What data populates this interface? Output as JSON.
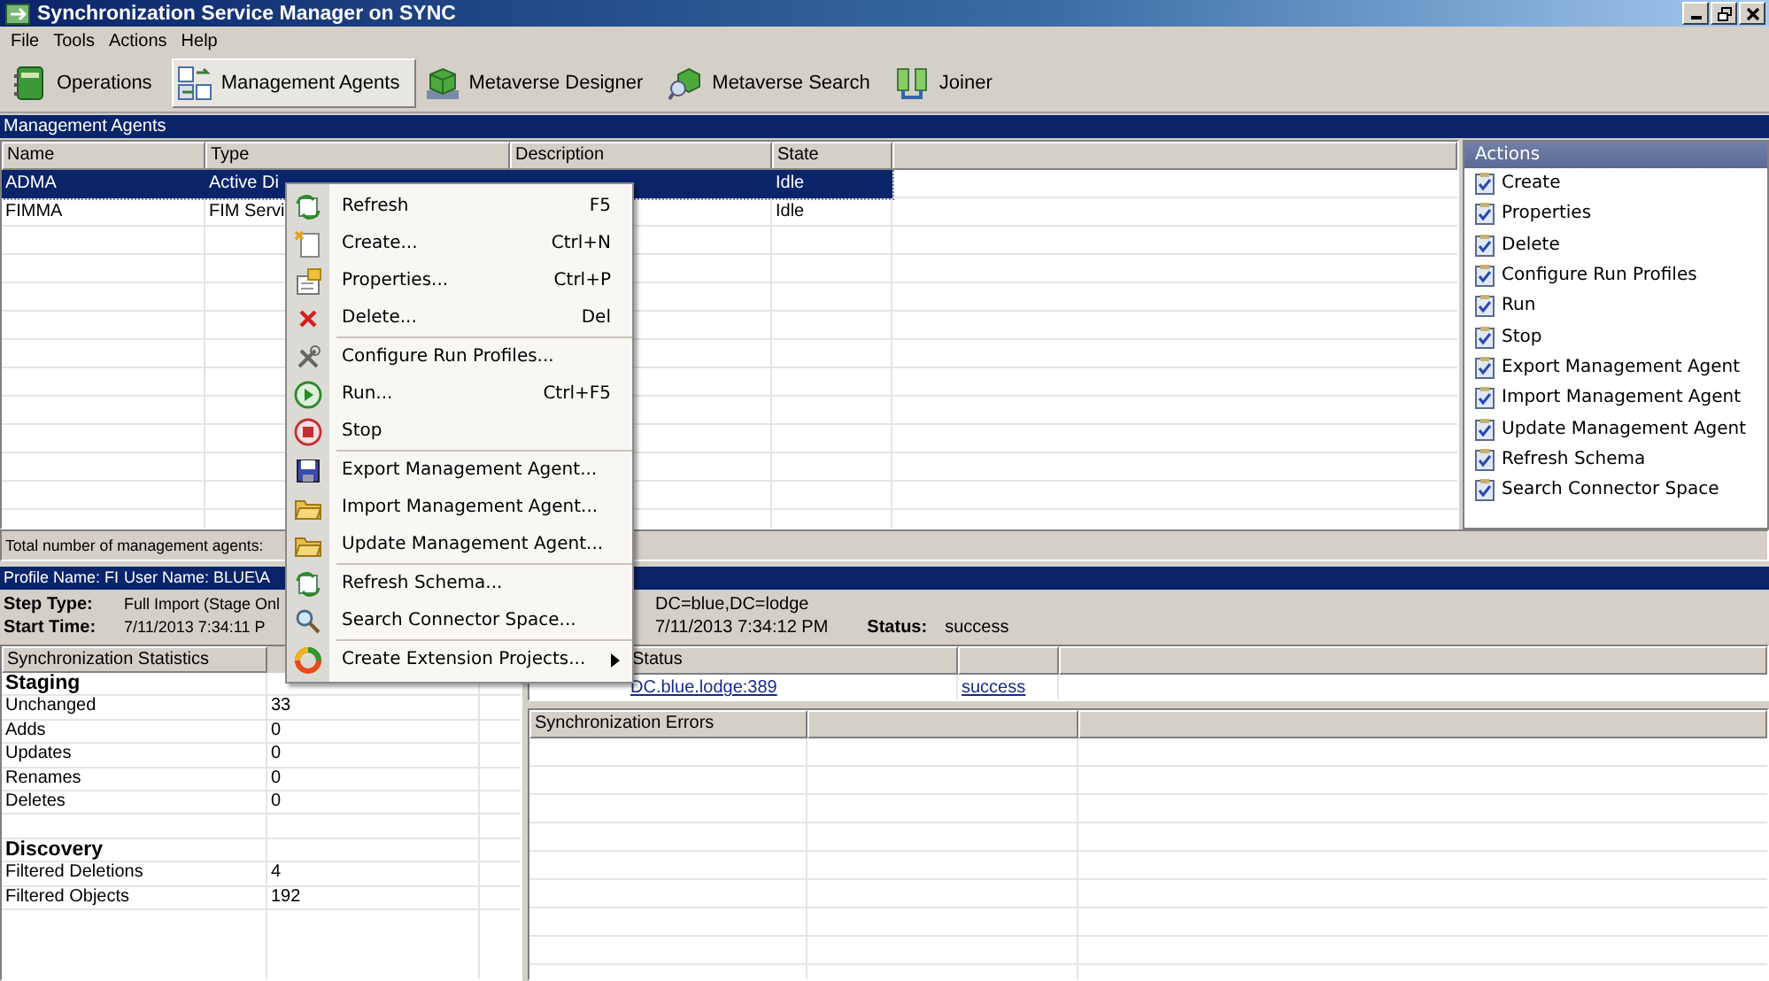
{
  "window": {
    "title": "Synchronization Service Manager on SYNC"
  },
  "menu_bar": [
    "File",
    "Tools",
    "Actions",
    "Help"
  ],
  "toolbar": [
    {
      "label": "Operations",
      "selected": false
    },
    {
      "label": "Management Agents",
      "selected": true
    },
    {
      "label": "Metaverse Designer",
      "selected": false
    },
    {
      "label": "Metaverse Search",
      "selected": false
    },
    {
      "label": "Joiner",
      "selected": false
    }
  ],
  "agents": {
    "title": "Management Agents",
    "columns": [
      "Name",
      "Type",
      "Description",
      "State"
    ],
    "rows": [
      {
        "cells": [
          "ADMA",
          "Active Di",
          "",
          "Idle"
        ],
        "selected": true
      },
      {
        "cells": [
          "FIMMA",
          "FIM Servi",
          "",
          "Idle"
        ],
        "selected": false
      }
    ],
    "footer": "Total number of management agents:"
  },
  "actions": {
    "title": "Actions",
    "items": [
      "Create",
      "Properties",
      "Delete",
      "Configure Run Profiles",
      "Run",
      "Stop",
      "Export Management Agent",
      "Import Management Agent",
      "Update Management Agent",
      "Refresh Schema",
      "Search Connector Space"
    ]
  },
  "run_details": {
    "header": [
      "Profile Name: FI",
      "User Name: BLUE\\A"
    ],
    "fields": [
      {
        "label": "Step Type:",
        "value": "Full Import (Stage Onl",
        "right_value": "DC=blue,DC=lodge"
      },
      {
        "label": "Start Time:",
        "value": "7/11/2013 7:34:11 P",
        "right_value": "7/11/2013 7:34:12 PM",
        "status_label": "Status:",
        "status": "success"
      }
    ]
  },
  "statistics": {
    "title": "Synchronization Statistics",
    "groups": [
      {
        "title": "Staging",
        "rows": [
          {
            "label": "Unchanged",
            "value": "33"
          },
          {
            "label": "Adds",
            "value": "0"
          },
          {
            "label": "Updates",
            "value": "0"
          },
          {
            "label": "Renames",
            "value": "0"
          },
          {
            "label": "Deletes",
            "value": "0"
          }
        ]
      },
      {
        "title": "Discovery",
        "rows": [
          {
            "label": "Filtered Deletions",
            "value": "4"
          },
          {
            "label": "Filtered Objects",
            "value": "192"
          }
        ]
      }
    ]
  },
  "connections": {
    "column": "Status",
    "rows": [
      {
        "server": "DC.blue.lodge:389",
        "status": "success"
      }
    ]
  },
  "errors": {
    "title": "Synchronization Errors"
  },
  "context_menu": {
    "groups": [
      [
        {
          "label": "Refresh",
          "shortcut": "F5"
        },
        {
          "label": "Create...",
          "shortcut": "Ctrl+N"
        },
        {
          "label": "Properties...",
          "shortcut": "Ctrl+P"
        },
        {
          "label": "Delete...",
          "shortcut": "Del"
        }
      ],
      [
        {
          "label": "Configure Run Profiles..."
        },
        {
          "label": "Run...",
          "shortcut": "Ctrl+F5"
        },
        {
          "label": "Stop"
        }
      ],
      [
        {
          "label": "Export Management Agent..."
        },
        {
          "label": "Import Management Agent..."
        },
        {
          "label": "Update Management Agent..."
        }
      ],
      [
        {
          "label": "Refresh Schema..."
        },
        {
          "label": "Search Connector Space..."
        }
      ],
      [
        {
          "label": "Create Extension Projects...",
          "submenu": true
        }
      ]
    ]
  }
}
